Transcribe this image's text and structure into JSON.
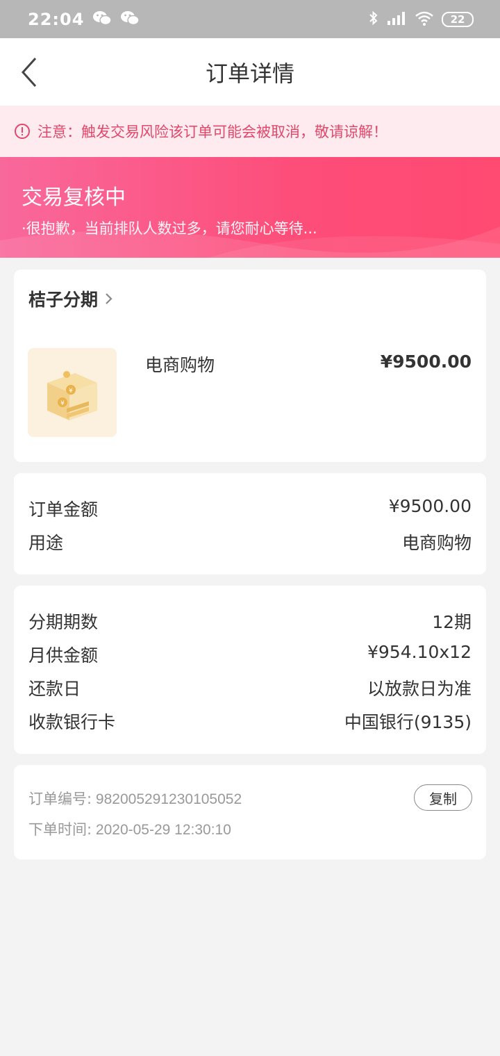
{
  "status_bar": {
    "time": "22:04",
    "battery": "22"
  },
  "nav": {
    "title": "订单详情"
  },
  "warning": {
    "text": "注意：触发交易风险该订单可能会被取消，敬请谅解！"
  },
  "banner": {
    "title": "交易复核中",
    "subtitle": "·很抱歉，当前排队人数过多，请您耐心等待..."
  },
  "product": {
    "merchant": "桔子分期",
    "name": "电商购物",
    "price": "¥9500.00"
  },
  "amount": {
    "rows": [
      {
        "label": "订单金额",
        "value": "¥9500.00"
      },
      {
        "label": "用途",
        "value": "电商购物"
      }
    ]
  },
  "installment": {
    "rows": [
      {
        "label": "分期期数",
        "value": "12期"
      },
      {
        "label": "月供金额",
        "value": "¥954.10x12"
      },
      {
        "label": "还款日",
        "value": "以放款日为准"
      },
      {
        "label": "收款银行卡",
        "value": "中国银行(9135)"
      }
    ]
  },
  "order": {
    "number_label": "订单编号:",
    "number": "982005291230105052",
    "time_label": "下单时间:",
    "time": "2020-05-29 12:30:10",
    "copy_label": "复制"
  },
  "colors": {
    "accent": "#fd4d79",
    "warning_text": "#e2486b",
    "warning_bg": "#fdebef"
  }
}
